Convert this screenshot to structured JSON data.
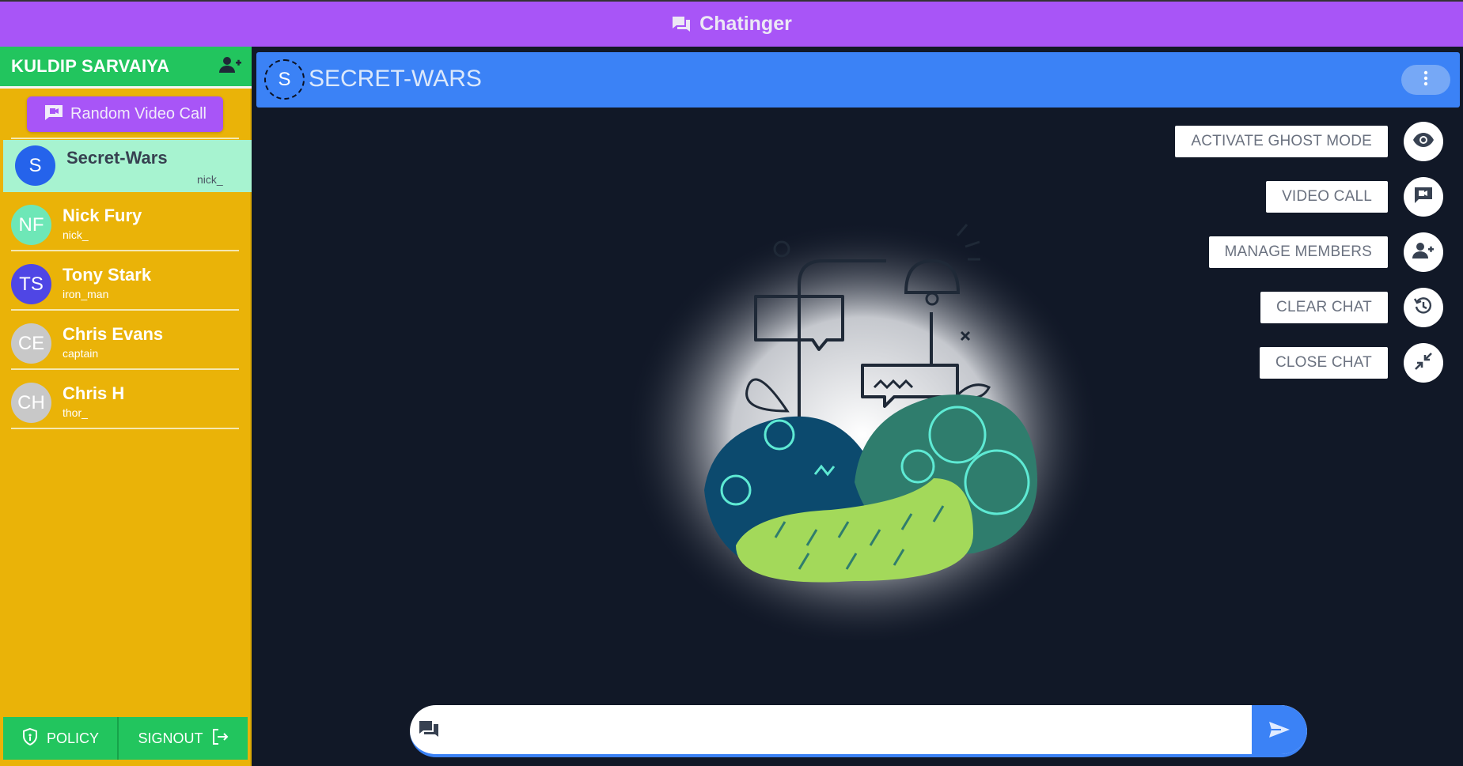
{
  "app": {
    "title": "Chatinger",
    "brand_icon": "chat-bubbles-icon"
  },
  "sidebar": {
    "username": "KULDIP SARVAIYA",
    "add_friend_icon": "add-user-icon",
    "random_video_call": "Random Video Call",
    "chats": [
      {
        "initials": "S",
        "name": "Secret-Wars",
        "sub": "nick_",
        "avatar_color": "#2563eb",
        "active": true
      },
      {
        "initials": "NF",
        "name": "Nick Fury",
        "sub": "nick_",
        "avatar_color": "#6ee7b7",
        "active": false
      },
      {
        "initials": "TS",
        "name": "Tony Stark",
        "sub": "iron_man",
        "avatar_color": "#4f46e5",
        "active": false
      },
      {
        "initials": "CE",
        "name": "Chris Evans",
        "sub": "captain",
        "avatar_color": "#c8c8c8",
        "active": false
      },
      {
        "initials": "CH",
        "name": "Chris H",
        "sub": "thor_",
        "avatar_color": "#c8c8c8",
        "active": false
      }
    ],
    "footer": {
      "policy": "POLICY",
      "signout": "SIGNOUT"
    }
  },
  "chat": {
    "avatar_initial": "S",
    "title": "SECRET-WARS",
    "actions": [
      {
        "label": "ACTIVATE GHOST MODE",
        "icon": "eye-icon"
      },
      {
        "label": "VIDEO CALL",
        "icon": "video-chat-icon"
      },
      {
        "label": "MANAGE MEMBERS",
        "icon": "add-user-icon"
      },
      {
        "label": "CLEAR CHAT",
        "icon": "history-icon"
      },
      {
        "label": "CLOSE CHAT",
        "icon": "collapse-icon"
      }
    ],
    "message_placeholder": ""
  },
  "colors": {
    "topbar": "#a855f7",
    "sidebar": "#eab308",
    "accent_green": "#22c55e",
    "active_chat": "#a7f3d0",
    "chat_header": "#3b82f6",
    "background": "#111827"
  }
}
